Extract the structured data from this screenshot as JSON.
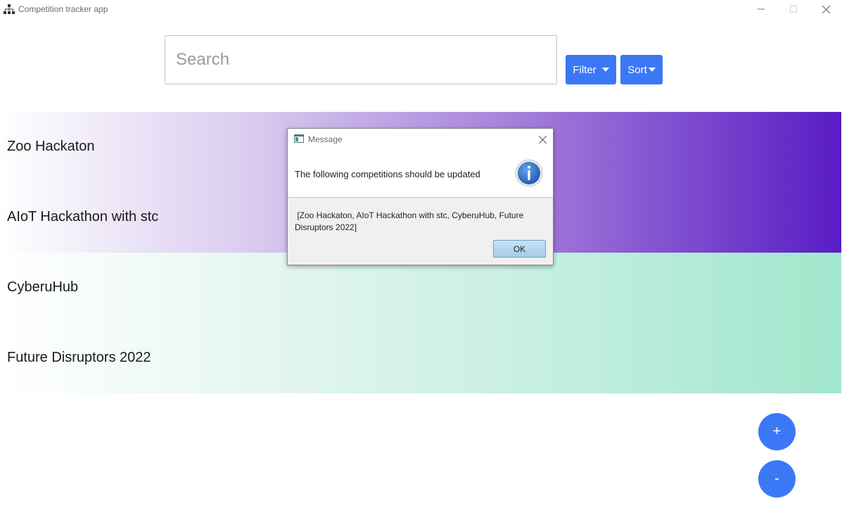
{
  "window": {
    "title": "Competition tracker app",
    "icon": "app-tree-icon",
    "controls": {
      "minimize": "minimize-icon",
      "maximize": "maximize-icon",
      "close": "close-icon"
    }
  },
  "search": {
    "placeholder": "Search",
    "value": ""
  },
  "toolbar": {
    "filter_label": "Filter",
    "sort_label": "Sort"
  },
  "competitions": [
    {
      "name": "Zoo Hackaton"
    },
    {
      "name": "AIoT Hackathon with stc"
    },
    {
      "name": "CyberuHub"
    },
    {
      "name": "Future Disruptors 2022"
    }
  ],
  "fab": {
    "add_label": "+",
    "remove_label": "-"
  },
  "dialog": {
    "title": "Message",
    "header_text": "The following competitions should be updated",
    "body_line1": " [Zoo Hackaton, AIoT Hackathon with stc, CyberuHub, Future",
    "body_line2": "Disruptors 2022]",
    "ok_label": "OK",
    "icon": "info-icon"
  },
  "colors": {
    "accent": "#3b78f5",
    "purple_band_end": "#5a1cc4",
    "green_band_end": "#a1e6cc"
  }
}
